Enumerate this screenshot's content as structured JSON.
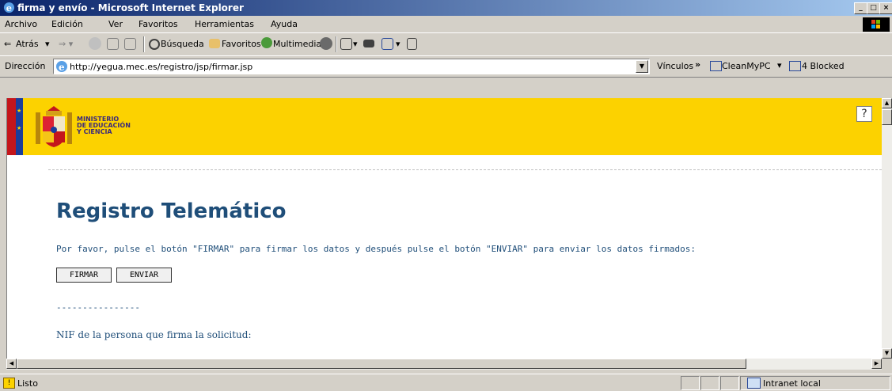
{
  "window": {
    "title": "firma y envío - Microsoft Internet Explorer",
    "buttons": [
      "_",
      "□",
      "×"
    ]
  },
  "menubar": {
    "items": [
      "Archivo",
      "Edición",
      "Ver",
      "Favoritos",
      "Herramientas",
      "Ayuda"
    ]
  },
  "toolbar": {
    "back_label": "Atrás",
    "search_label": "Búsqueda",
    "favorites_label": "Favoritos",
    "multimedia_label": "Multimedia"
  },
  "addressbar": {
    "label": "Dirección",
    "url": "http://yegua.mec.es/registro/jsp/firmar.jsp",
    "links_label": "Vínculos",
    "links_chevron": "»",
    "link1": "CleanMyPC",
    "link2": "4 Blocked"
  },
  "banner": {
    "ministry_line1": "MINISTERIO",
    "ministry_line2": "DE EDUCACIÓN",
    "ministry_line3": "Y CIENCIA",
    "help": "?"
  },
  "main": {
    "title": "Registro Telemático",
    "instructions": "Por favor, pulse el botón \"FIRMAR\" para firmar los datos y después pulse el botón \"ENVIAR\" para enviar los datos firmados:",
    "sign_button": "FIRMAR",
    "send_button": "ENVIAR",
    "separator": "----------------",
    "nif_label": "NIF de la persona que firma la solicitud:"
  },
  "statusbar": {
    "status": "Listo",
    "zone": "Intranet local"
  },
  "colors": {
    "title_gradient_start": "#0a246a",
    "banner_yellow": "#fcd200",
    "text_blue": "#1f4e79"
  }
}
